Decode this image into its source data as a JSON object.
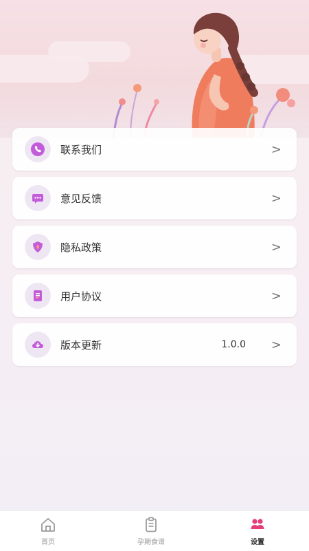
{
  "menu": [
    {
      "label": "联系我们",
      "icon": "phone-icon",
      "value": ""
    },
    {
      "label": "意见反馈",
      "icon": "chat-icon",
      "value": ""
    },
    {
      "label": "隐私政策",
      "icon": "shield-icon",
      "value": ""
    },
    {
      "label": "用户协议",
      "icon": "document-icon",
      "value": ""
    },
    {
      "label": "版本更新",
      "icon": "cloud-download-icon",
      "value": "1.0.0"
    }
  ],
  "chevron": ">",
  "tabs": [
    {
      "label": "首页",
      "icon": "home-icon",
      "active": false
    },
    {
      "label": "孕期食谱",
      "icon": "clipboard-icon",
      "active": false
    },
    {
      "label": "设置",
      "icon": "users-icon",
      "active": true
    }
  ],
  "colors": {
    "accent": "#e63e7a",
    "icon_bg": "#efe6f4",
    "tab_inactive": "#9a9a9a"
  }
}
